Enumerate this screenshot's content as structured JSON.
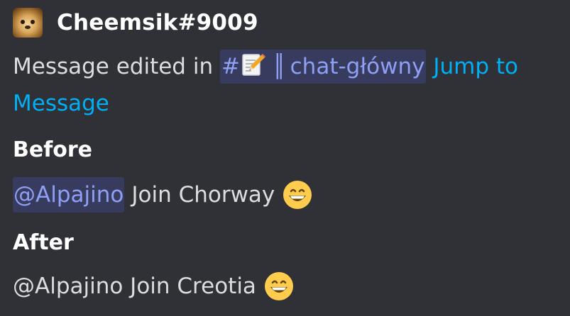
{
  "embed": {
    "author": {
      "name": "Cheemsik#9009",
      "avatar_icon": "dog-avatar"
    },
    "description": {
      "prefix": "Message edited in",
      "channel": {
        "hash": "#",
        "emoji": "pencil-memo-icon",
        "separator": "║",
        "name": "chat-główny"
      },
      "jump_link_part1": "Jump to",
      "jump_link_part2": "Message"
    },
    "fields": {
      "before": {
        "name": "Before",
        "mention": "@Alpajino",
        "text": "Join Chorway",
        "emoji": "grinning-face-icon"
      },
      "after": {
        "name": "After",
        "text": "@Alpajino Join Creotia",
        "emoji": "grinning-face-icon"
      }
    },
    "colors": {
      "background": "#2f3136",
      "link": "#00aff4",
      "mention": "#8f9ff5",
      "mention_bg": "rgba(88,101,242,0.22)"
    }
  }
}
